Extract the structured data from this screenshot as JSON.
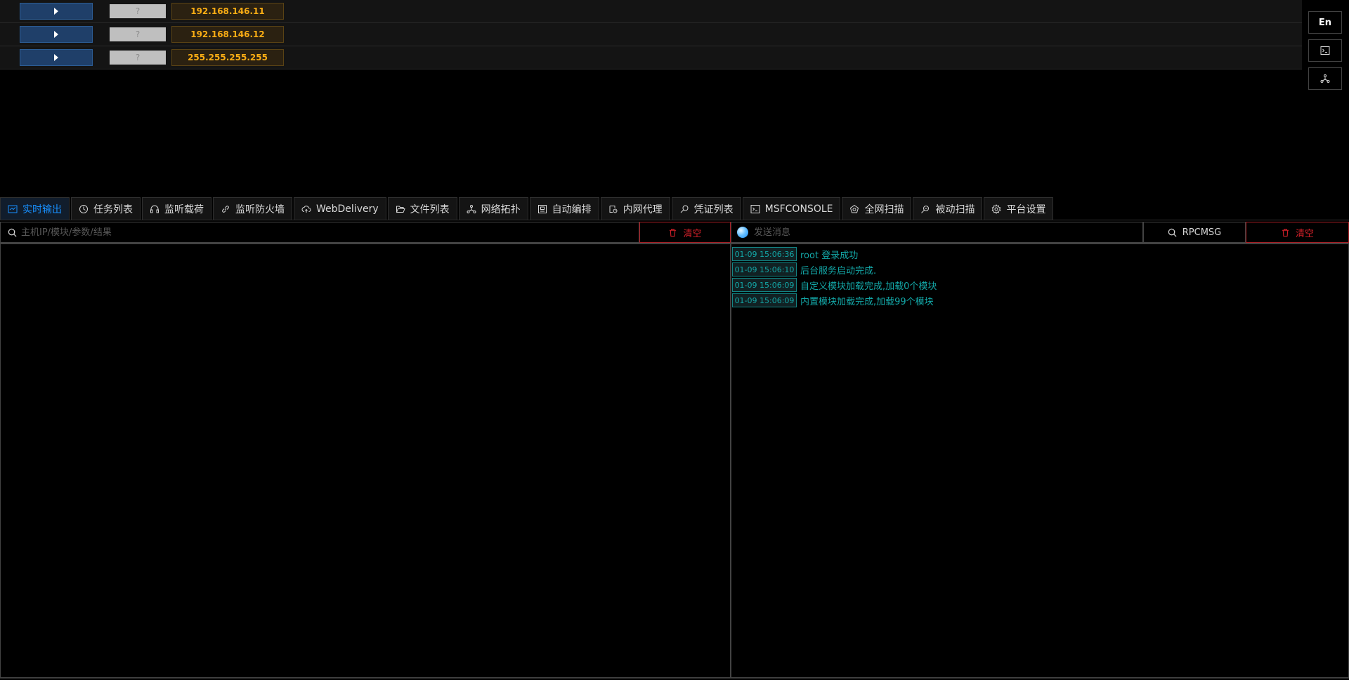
{
  "hosts": [
    {
      "os": "?",
      "ip": "192.168.146.11"
    },
    {
      "os": "?",
      "ip": "192.168.146.12"
    },
    {
      "os": "?",
      "ip": "255.255.255.255"
    }
  ],
  "side_buttons": {
    "lang": "En",
    "console_icon": "terminal-icon",
    "topology_icon": "network-topology-icon"
  },
  "tabs": [
    {
      "label": "实时输出",
      "icon": "realtime-output-icon",
      "active": true
    },
    {
      "label": "任务列表",
      "icon": "clock-icon"
    },
    {
      "label": "监听载荷",
      "icon": "headphones-icon"
    },
    {
      "label": "监听防火墙",
      "icon": "link-icon"
    },
    {
      "label": "WebDelivery",
      "icon": "cloud-upload-icon"
    },
    {
      "label": "文件列表",
      "icon": "folder-open-icon"
    },
    {
      "label": "网络拓扑",
      "icon": "topology-icon"
    },
    {
      "label": "自动编排",
      "icon": "robot-icon"
    },
    {
      "label": "内网代理",
      "icon": "proxy-icon"
    },
    {
      "label": "凭证列表",
      "icon": "key-search-icon"
    },
    {
      "label": "MSFCONSOLE",
      "icon": "terminal-icon"
    },
    {
      "label": "全网扫描",
      "icon": "radar-icon"
    },
    {
      "label": "被动扫描",
      "icon": "file-search-icon"
    },
    {
      "label": "平台设置",
      "icon": "gear-icon"
    }
  ],
  "left": {
    "search_placeholder": "主机IP/模块/参数/结果",
    "clear_label": "清空"
  },
  "right": {
    "message_placeholder": "发送消息",
    "rpc_label": "RPCMSG",
    "clear_label": "清空",
    "logs": [
      {
        "time": "01-09 15:06:36",
        "text": "root 登录成功"
      },
      {
        "time": "01-09 15:06:10",
        "text": "后台服务启动完成."
      },
      {
        "time": "01-09 15:06:09",
        "text": "自定义模块加载完成,加载0个模块"
      },
      {
        "time": "01-09 15:06:09",
        "text": "内置模块加载完成,加载99个模块"
      }
    ]
  },
  "colors": {
    "accent": "#1890ff",
    "danger": "#d32029",
    "ip": "#faad14",
    "log": "#13a8a8"
  }
}
